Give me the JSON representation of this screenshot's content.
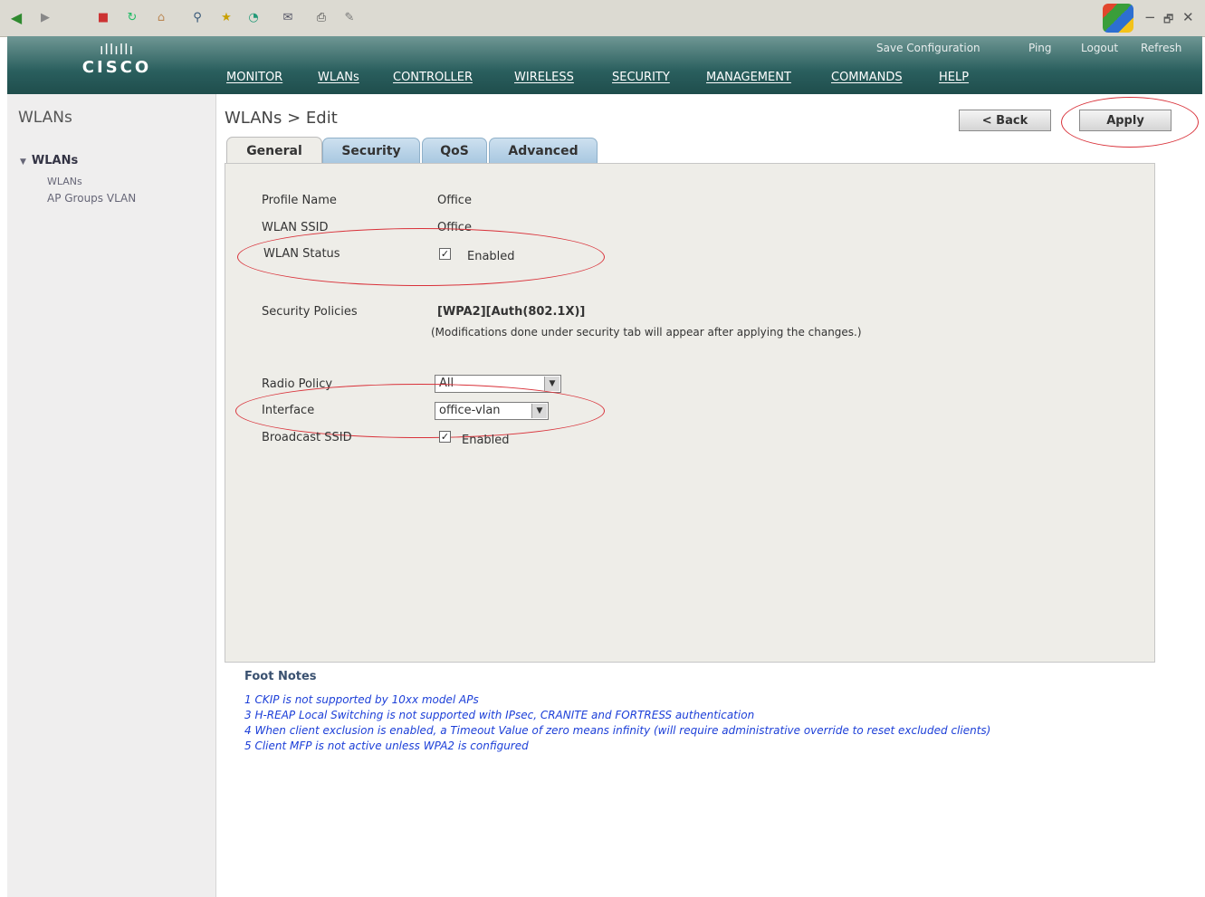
{
  "toolbar": {
    "icons": [
      "back-icon",
      "forward-icon",
      "stop-icon",
      "refresh-icon",
      "home-icon",
      "search-icon",
      "favorites-icon",
      "history-icon",
      "mail-icon",
      "print-icon",
      "edit-icon"
    ],
    "window_controls": [
      "−",
      "🗗",
      "✕"
    ]
  },
  "header": {
    "logo_text": "CISCO",
    "top_links": [
      "Save Configuration",
      "Ping",
      "Logout",
      "Refresh"
    ],
    "nav": [
      "MONITOR",
      "WLANs",
      "CONTROLLER",
      "WIRELESS",
      "SECURITY",
      "MANAGEMENT",
      "COMMANDS",
      "HELP"
    ]
  },
  "sidebar": {
    "title": "WLANs",
    "tree_head": "WLANs",
    "items": [
      "WLANs",
      "AP Groups VLAN"
    ]
  },
  "main": {
    "title": "WLANs > Edit",
    "back_label": "< Back",
    "apply_label": "Apply",
    "tabs": [
      "General",
      "Security",
      "QoS",
      "Advanced"
    ],
    "active_tab": "General"
  },
  "form": {
    "profile_name_label": "Profile Name",
    "profile_name": "Office",
    "ssid_label": "WLAN SSID",
    "ssid": "Office",
    "status_label": "WLAN Status",
    "status_checked": true,
    "status_text": "Enabled",
    "security_label": "Security Policies",
    "security_value": "[WPA2][Auth(802.1X)]",
    "security_note": "(Modifications done under security tab will appear after applying the changes.)",
    "radio_policy_label": "Radio Policy",
    "radio_policy_value": "All",
    "interface_label": "Interface",
    "interface_value": "office-vlan",
    "broadcast_label": "Broadcast SSID",
    "broadcast_checked": true,
    "broadcast_text": "Enabled"
  },
  "footnotes": {
    "title": "Foot Notes",
    "items": [
      "1 CKIP is not supported by 10xx model APs",
      "3 H-REAP Local Switching is not supported with IPsec, CRANITE and FORTRESS authentication",
      "4 When client exclusion is enabled, a Timeout Value of zero means infinity (will require administrative override to reset excluded clients)",
      "5 Client MFP is not active unless WPA2 is configured"
    ]
  },
  "colors": {
    "header": "#2a5f5e",
    "annotation": "#d9323a",
    "footnote_text": "#1c3fd8"
  }
}
